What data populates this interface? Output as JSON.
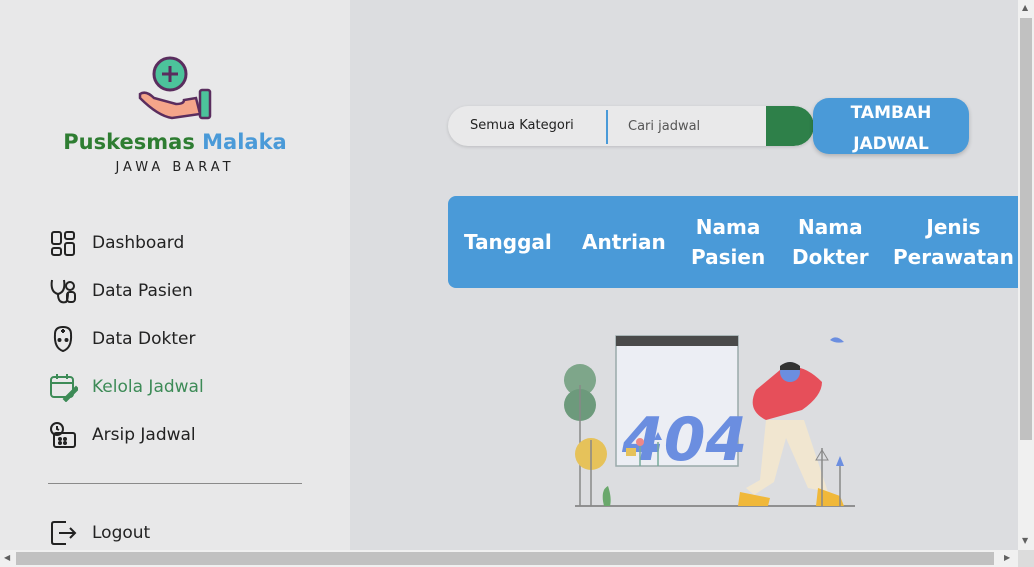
{
  "brand": {
    "name_part1": "Puskesmas",
    "name_part2": "Malaka",
    "subtitle": "JAWA BARAT",
    "icon": "hand-plus-icon"
  },
  "colors": {
    "green": "#2e7d32",
    "blue": "#4a9ad8",
    "active_green": "#3d8b57"
  },
  "sidebar": {
    "items": [
      {
        "label": "Dashboard",
        "icon": "dashboard-icon"
      },
      {
        "label": "Data Pasien",
        "icon": "stethoscope-icon"
      },
      {
        "label": "Data Dokter",
        "icon": "doctor-icon"
      },
      {
        "label": "Kelola Jadwal",
        "icon": "calendar-edit-icon",
        "active": true
      },
      {
        "label": "Arsip Jadwal",
        "icon": "archive-calendar-icon"
      }
    ],
    "logout": {
      "label": "Logout",
      "icon": "logout-icon"
    }
  },
  "search": {
    "category": "Semua Kategori",
    "placeholder": "Cari jadwal",
    "submit_icon": "search-submit"
  },
  "add_button": {
    "line1": "TAMBAH",
    "line2": "JADWAL"
  },
  "table": {
    "headers": [
      {
        "line1": "Tanggal",
        "line2": ""
      },
      {
        "line1": "Antrian",
        "line2": ""
      },
      {
        "line1": "Nama",
        "line2": "Pasien"
      },
      {
        "line1": "Nama",
        "line2": "Dokter"
      },
      {
        "line1": "Jenis",
        "line2": "Perawatan"
      }
    ]
  },
  "empty_state": {
    "code": "404",
    "icon": "404-illustration"
  }
}
